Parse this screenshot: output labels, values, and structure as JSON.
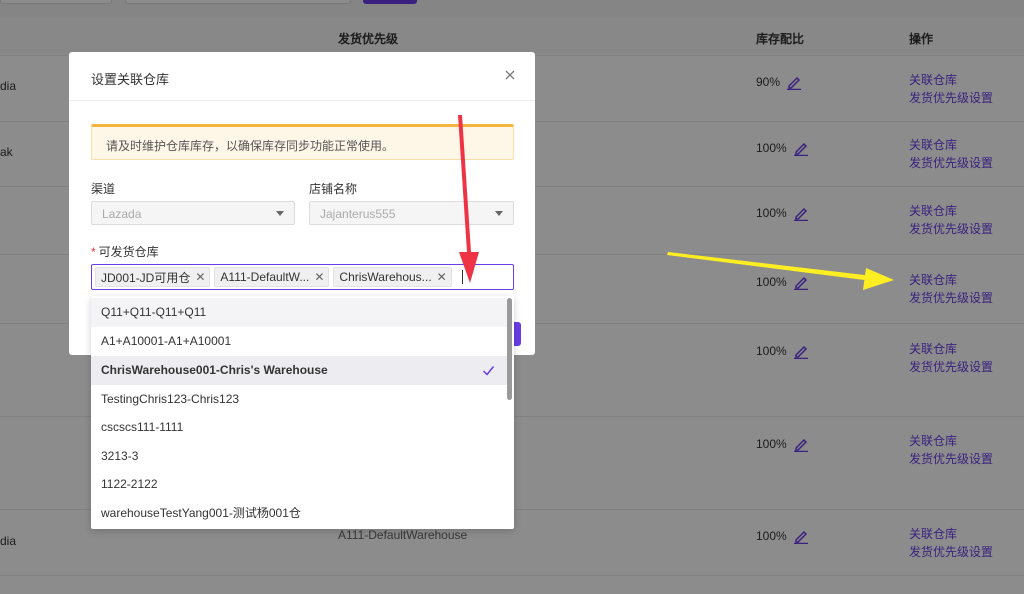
{
  "table": {
    "headers": {
      "priority": "发货优先级",
      "ratio": "库存配比",
      "ops": "操作"
    },
    "rows": [
      {
        "name": "dia",
        "priority": "",
        "ratio": "90%",
        "link1": "关联仓库",
        "link2": "发货优先级设置"
      },
      {
        "name": "ak",
        "priority": "",
        "ratio": "100%",
        "link1": "关联仓库",
        "link2": "发货优先级设置"
      },
      {
        "name": "",
        "priority": "",
        "ratio": "100%",
        "link1": "关联仓库",
        "link2": "发货优先级设置"
      },
      {
        "name": "",
        "priority": "",
        "ratio": "100%",
        "link1": "关联仓库",
        "link2": "发货优先级设置"
      },
      {
        "name": "",
        "priority": "",
        "ratio": "100%",
        "link1": "关联仓库",
        "link2": "发货优先级设置"
      },
      {
        "name": "",
        "priority": "",
        "ratio": "100%",
        "link1": "关联仓库",
        "link2": "发货优先级设置"
      },
      {
        "name": "dia",
        "priority": "A111-DefaultWarehouse",
        "ratio": "100%",
        "link1": "关联仓库",
        "link2": "发货优先级设置"
      }
    ]
  },
  "modal": {
    "title": "设置关联仓库",
    "alert": "请及时维护仓库库存，以确保库存同步功能正常使用。",
    "channel_label": "渠道",
    "channel_value": "Lazada",
    "shop_label": "店铺名称",
    "shop_value": "Jajanterus555",
    "warehouse_required": "*",
    "warehouse_label": "可发货仓库",
    "tags": [
      "JD001-JD可用仓",
      "A111-DefaultW...",
      "ChrisWarehous..."
    ]
  },
  "dropdown": {
    "options": [
      "Q11+Q11-Q11+Q11",
      "A1+A10001-A1+A10001",
      "ChrisWarehouse001-Chris's Warehouse",
      "TestingChris123-Chris123",
      "cscscs111-1111",
      "3213-3",
      "1122-2122",
      "warehouseTestYang001-测试杨001仓"
    ],
    "selected_index": 2
  },
  "colors": {
    "accent": "#6a3de8",
    "alert_border": "#f5b340",
    "arrow_red": "#ee3344",
    "arrow_yellow": "#ffee22"
  }
}
